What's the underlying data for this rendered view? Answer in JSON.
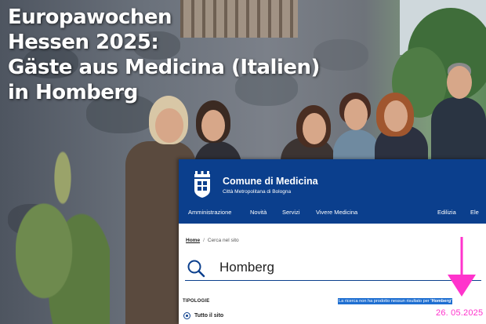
{
  "headline": {
    "line1": "Europawochen",
    "line2": "Hessen 2025:",
    "line3": "Gäste aus Medicina (Italien)",
    "line4": "in Homberg"
  },
  "site": {
    "title": "Comune di Medicina",
    "subtitle": "Città Metropolitana di Bologna",
    "brand_color": "#0b3f8d"
  },
  "nav": {
    "items": [
      {
        "label": "Amministrazione"
      },
      {
        "label": "Novità"
      },
      {
        "label": "Servizi"
      },
      {
        "label": "Vivere Medicina"
      },
      {
        "label": "Edilizia"
      },
      {
        "label": "Ele"
      }
    ]
  },
  "breadcrumb": {
    "home": "Home",
    "separator": "/",
    "current": "Cerca nel sito"
  },
  "search": {
    "value": "Homberg",
    "icon": "search-icon"
  },
  "filters": {
    "title": "TIPOLOGIE",
    "option_label": "Tutto il sito",
    "option_selected": true
  },
  "results": {
    "message": "La ricerca non ha prodotto nessun risultato per ",
    "term": "'Homberg'",
    "highlight_color": "#1f6fd1"
  },
  "annotation": {
    "date": "26. 05.2025",
    "color": "#ff33cc",
    "icon": "arrow-down-icon"
  }
}
